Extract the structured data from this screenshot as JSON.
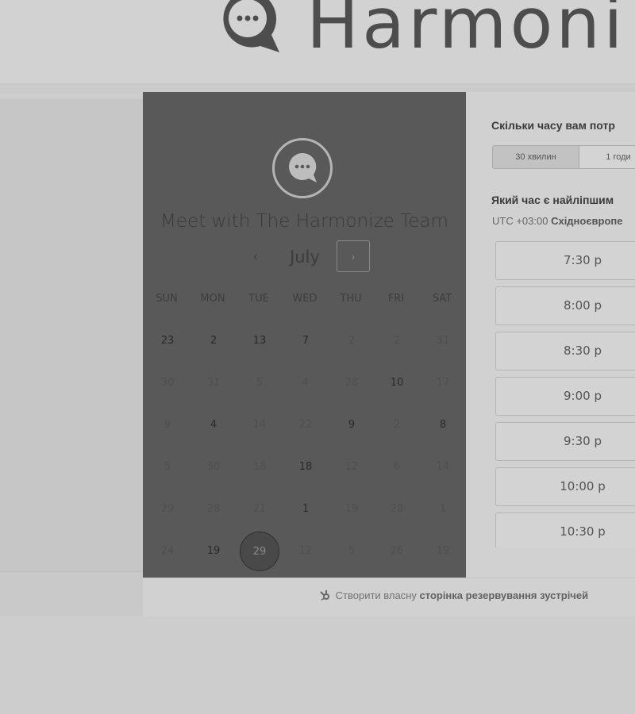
{
  "header": {
    "brand_text": "Harmoni",
    "logo_icon": "chat-bubble-logo-icon"
  },
  "scheduler": {
    "title": "Meet with The Harmonize Team",
    "avatar_icon": "chat-bubble-icon",
    "month": "July",
    "prev_label": "‹",
    "next_label": "›",
    "weekdays": [
      "SUN",
      "MON",
      "TUE",
      "WED",
      "THU",
      "FRI",
      "SAT"
    ],
    "weeks": [
      [
        "23",
        "2",
        "13",
        "7",
        "2",
        "2",
        "31"
      ],
      [
        "30",
        "31",
        "5",
        "4",
        "28",
        "10",
        "17"
      ],
      [
        "9",
        "4",
        "14",
        "22",
        "9",
        "2",
        "8"
      ],
      [
        "5",
        "30",
        "18",
        "18",
        "12",
        "6",
        "14"
      ],
      [
        "29",
        "28",
        "21",
        "1",
        "19",
        "28",
        "1"
      ],
      [
        "24",
        "19",
        "29",
        "12",
        "5",
        "26",
        "19"
      ]
    ],
    "available": [
      [
        0,
        0
      ],
      [
        0,
        1
      ],
      [
        0,
        2
      ],
      [
        0,
        3
      ],
      [
        1,
        5
      ],
      [
        2,
        1
      ],
      [
        2,
        4
      ],
      [
        2,
        6
      ],
      [
        3,
        3
      ],
      [
        4,
        3
      ],
      [
        5,
        1
      ]
    ],
    "selected": [
      5,
      2
    ]
  },
  "booking": {
    "duration_question": "Скільки часу вам потр",
    "durations": [
      "30 хвилин",
      "1 годи"
    ],
    "time_question": "Який час є найліпшим",
    "timezone_offset": "UTC +03:00",
    "timezone_name": "Східноєвропе",
    "slots": [
      "7:30 p",
      "8:00 p",
      "8:30 p",
      "9:00 p",
      "9:30 p",
      "10:00 p",
      "10:30 p"
    ]
  },
  "footer": {
    "link_prefix": "Створити власну",
    "link_bold": "сторінка резервування зустрічей",
    "icon": "hubspot-sprocket-icon"
  },
  "colors": {
    "panel_dark": "#595959",
    "page_bg": "#cdcdcd",
    "panel_light": "#d1d1d1"
  }
}
